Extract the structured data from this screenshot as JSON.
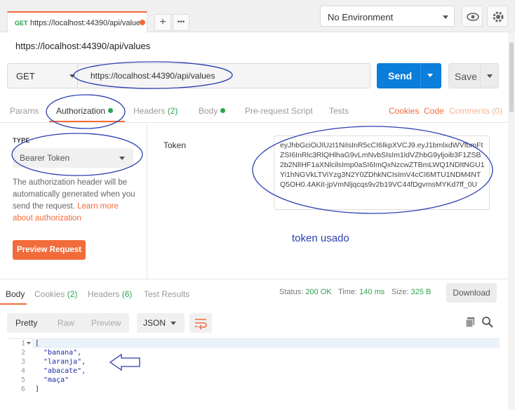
{
  "tab": {
    "method": "GET",
    "url": "https://localhost:44390/api/value"
  },
  "tab_actions": {
    "new_tab": "+",
    "more": "•••"
  },
  "environment": {
    "selected": "No Environment"
  },
  "request": {
    "title": "https://localhost:44390/api/values",
    "method": "GET",
    "url": "https://localhost:44390/api/values",
    "send_label": "Send",
    "save_label": "Save"
  },
  "request_tabs": {
    "params": "Params",
    "authorization": "Authorization",
    "headers": "Headers",
    "headers_count": "(2)",
    "body": "Body",
    "prerequest": "Pre-request Script",
    "tests": "Tests",
    "cookies": "Cookies",
    "code": "Code",
    "comments": "Comments (0)"
  },
  "auth": {
    "type_label": "TYPE",
    "type_value": "Bearer Token",
    "description": "The authorization header will be automatically generated when you send the request.",
    "learn_more": "Learn more about authorization",
    "preview_button": "Preview Request",
    "token_label": "Token",
    "token_value": "eyJhbGciOiJIUzI1NiIsInR5cCI6IkpXVCJ9.eyJ1bmlxdWVfbmFtZSI6InRlc3RlQHlhaG9vLmNvbSIsIm1ldVZhbG9yljoib3F1ZSB2b2NlIHF1aXNlcilsImp0aSI6ImQxNzcwZTBmLWQ1NDItNGU1Yi1hNGVkLTViYzg3N2Y0ZDhkNCIsImV4cCI6MTU1NDM4NTQ5OH0.4AKit-jpVmNljqcqs9v2b19VC44fDgvmsMYKd7ff_0U"
  },
  "annotation": {
    "text": "token usado"
  },
  "response_tabs": {
    "body": "Body",
    "cookies": "Cookies",
    "cookies_count": "(2)",
    "headers": "Headers",
    "headers_count": "(6)",
    "test_results": "Test Results"
  },
  "response_status": {
    "status_label": "Status:",
    "status_value": "200 OK",
    "time_label": "Time:",
    "time_value": "140 ms",
    "size_label": "Size:",
    "size_value": "325 B",
    "download_label": "Download"
  },
  "view_modes": {
    "pretty": "Pretty",
    "raw": "Raw",
    "preview": "Preview",
    "format": "JSON"
  },
  "response_lines": [
    {
      "num": "1",
      "text": "["
    },
    {
      "num": "2",
      "text": "\"banana\","
    },
    {
      "num": "3",
      "text": "\"laranja\","
    },
    {
      "num": "4",
      "text": "\"abacate\","
    },
    {
      "num": "5",
      "text": "\"maça\""
    },
    {
      "num": "6",
      "text": "]"
    }
  ],
  "colors": {
    "accent_orange": "#f26b3a",
    "send_blue": "#0b7ddb",
    "success_green": "#2ea44f",
    "annotation_blue": "#2b3fb0"
  }
}
